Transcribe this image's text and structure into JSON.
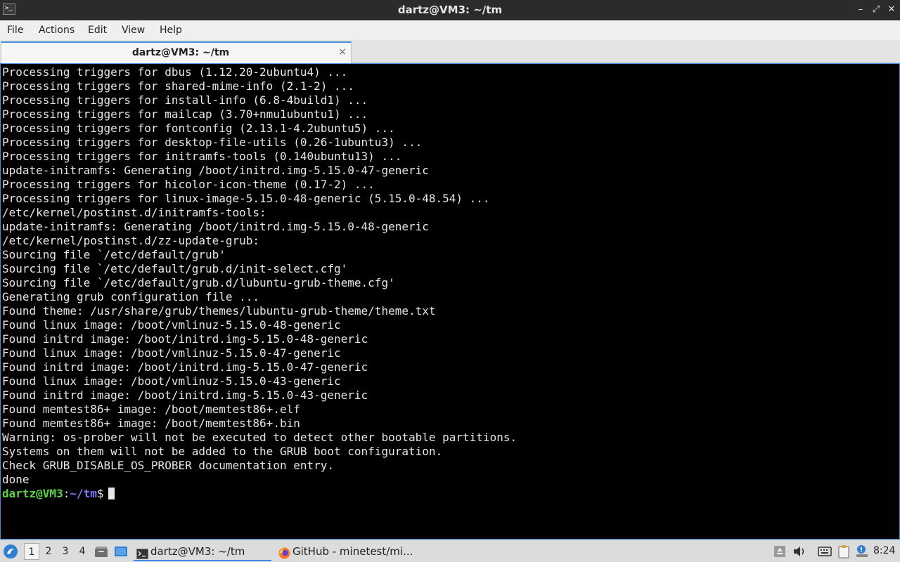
{
  "window": {
    "title": "dartz@VM3: ~/tm",
    "controls": {
      "minimize": "–",
      "maximize": "⤢",
      "close": "✕"
    }
  },
  "menu": {
    "items": [
      "File",
      "Actions",
      "Edit",
      "View",
      "Help"
    ]
  },
  "tab": {
    "label": "dartz@VM3: ~/tm",
    "close": "×"
  },
  "terminal": {
    "lines": [
      "Processing triggers for dbus (1.12.20-2ubuntu4) ...",
      "Processing triggers for shared-mime-info (2.1-2) ...",
      "Processing triggers for install-info (6.8-4build1) ...",
      "Processing triggers for mailcap (3.70+nmu1ubuntu1) ...",
      "Processing triggers for fontconfig (2.13.1-4.2ubuntu5) ...",
      "Processing triggers for desktop-file-utils (0.26-1ubuntu3) ...",
      "Processing triggers for initramfs-tools (0.140ubuntu13) ...",
      "update-initramfs: Generating /boot/initrd.img-5.15.0-47-generic",
      "Processing triggers for hicolor-icon-theme (0.17-2) ...",
      "Processing triggers for linux-image-5.15.0-48-generic (5.15.0-48.54) ...",
      "/etc/kernel/postinst.d/initramfs-tools:",
      "update-initramfs: Generating /boot/initrd.img-5.15.0-48-generic",
      "/etc/kernel/postinst.d/zz-update-grub:",
      "Sourcing file `/etc/default/grub'",
      "Sourcing file `/etc/default/grub.d/init-select.cfg'",
      "Sourcing file `/etc/default/grub.d/lubuntu-grub-theme.cfg'",
      "Generating grub configuration file ...",
      "Found theme: /usr/share/grub/themes/lubuntu-grub-theme/theme.txt",
      "Found linux image: /boot/vmlinuz-5.15.0-48-generic",
      "Found initrd image: /boot/initrd.img-5.15.0-48-generic",
      "Found linux image: /boot/vmlinuz-5.15.0-47-generic",
      "Found initrd image: /boot/initrd.img-5.15.0-47-generic",
      "Found linux image: /boot/vmlinuz-5.15.0-43-generic",
      "Found initrd image: /boot/initrd.img-5.15.0-43-generic",
      "Found memtest86+ image: /boot/memtest86+.elf",
      "Found memtest86+ image: /boot/memtest86+.bin",
      "Warning: os-prober will not be executed to detect other bootable partitions.",
      "Systems on them will not be added to the GRUB boot configuration.",
      "Check GRUB_DISABLE_OS_PROBER documentation entry.",
      "done"
    ],
    "prompt": {
      "user_host": "dartz@VM3",
      "sep": ":",
      "path": "~/tm",
      "symbol": "$"
    },
    "colors": {
      "background": "#000000",
      "foreground": "#e6e6e6",
      "prompt_user": "#55d83c",
      "prompt_path": "#7b7bff"
    }
  },
  "taskbar": {
    "workspaces": [
      "1",
      "2",
      "3",
      "4"
    ],
    "active_workspace": "1",
    "tasks": [
      {
        "label": "dartz@VM3: ~/tm",
        "icon": "terminal-icon",
        "active": true
      },
      {
        "label": "GitHub - minetest/mi...",
        "icon": "firefox-icon",
        "active": false
      }
    ],
    "tray_icons": [
      "update-icon",
      "volume-icon",
      "keyboard-icon",
      "clipboard-icon",
      "notification-icon"
    ],
    "clock": "8:24"
  }
}
